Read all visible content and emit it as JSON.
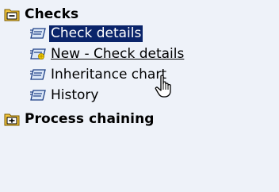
{
  "tree": {
    "groups": [
      {
        "label": "Checks",
        "expanded": true,
        "icon": "minus-box-icon",
        "items": [
          {
            "label": "Check details",
            "icon": "form-icon",
            "selected": true
          },
          {
            "label": "New - Check details",
            "icon": "new-form-icon",
            "hovered": true
          },
          {
            "label": "Inheritance chart",
            "icon": "form-icon"
          },
          {
            "label": "History",
            "icon": "form-icon"
          }
        ]
      },
      {
        "label": "Process chaining",
        "expanded": false,
        "icon": "plus-box-icon",
        "items": []
      }
    ]
  },
  "colors": {
    "background": "#eef2f9",
    "selection": "#0a246a",
    "folder": "#f2c53d"
  },
  "cursor": "hand-pointer-icon"
}
